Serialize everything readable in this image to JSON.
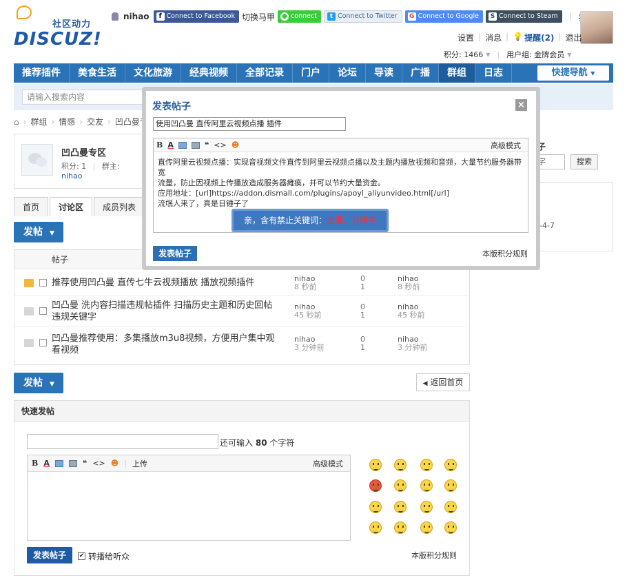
{
  "header": {
    "logo_tagline": "社区动力",
    "logo_word": "DISCUZ!",
    "username": "nihao",
    "connect_facebook": "Connect to Facebook",
    "switch_vest": "切换马甲",
    "connect_line": "connect",
    "connect_twitter": "Connect to Twitter",
    "connect_google": "Connect to Google",
    "connect_steam": "Connect to Steam",
    "my": "我的",
    "settings": "设置",
    "messages": "消息",
    "reminders": "提醒(2)",
    "logout": "退出",
    "points": "积分: 1466",
    "usergroup": "用户组: 金牌会员"
  },
  "nav": {
    "items": [
      "推荐插件",
      "美食生活",
      "文化旅游",
      "经典视频",
      "全部记录",
      "门户",
      "论坛",
      "导读",
      "广播",
      "群组",
      "日志"
    ],
    "quick": "快捷导航"
  },
  "search": {
    "placeholder": "请输入搜索内容"
  },
  "breadcrumb": [
    "群组",
    "情感",
    "交友",
    "凹凸曼专"
  ],
  "group": {
    "name": "凹凸曼专区",
    "points": "积分: 1",
    "leader_label": "群主:",
    "leader": "nihao"
  },
  "tabs": [
    "首页",
    "讨论区",
    "成员列表",
    "管"
  ],
  "post_button": "发帖",
  "threads": {
    "header": "帖子",
    "rows": [
      {
        "title": "推荐使用凹凸曼 直传七牛云视频播放 播放视频插件",
        "author": "nihao",
        "author_time": "8 秒前",
        "replies": "0",
        "views": "1",
        "last": "nihao",
        "last_time": "8 秒前"
      },
      {
        "title": "凹凸曼 洗内容扫描违规帖插件 扫描历史主题和历史回帖违规关键字",
        "author": "nihao",
        "author_time": "45 秒前",
        "replies": "0",
        "views": "1",
        "last": "nihao",
        "last_time": "45 秒前"
      },
      {
        "title": "凹凸曼推荐使用：多集播放m3u8视频，方便用户集中观看视频",
        "author": "nihao",
        "author_time": "3 分钟前",
        "replies": "0",
        "views": "1",
        "last": "nihao",
        "last_time": "3 分钟前"
      }
    ]
  },
  "back_home": "返回首页",
  "quick_post": {
    "title": "快速发帖",
    "count_prefix": "还可输入",
    "count": "80",
    "count_suffix": "个字符",
    "upload": "上传",
    "advanced": "高级模式",
    "submit": "发表帖子",
    "broadcast": "转播给听众",
    "rules": "本版积分规则"
  },
  "right": {
    "post_label": "发帖子",
    "keyword": "关键字",
    "search_btn": "搜索",
    "date": "022-4-7"
  },
  "modal": {
    "title": "发表帖子",
    "subject": "使用凹凸曼 直传阿里云视频点播 插件",
    "advanced": "高级模式",
    "content_lines": [
      "直传阿里云视频点播：实现音视频文件直传到阿里云视频点播以及主题内播放视频和音频，大量节约服务器带宽",
      "流量，防止因视频上传播放造成服务器瘫痪，并可以节约大量资金。",
      "应用地址：[url]https://addon.dismall.com/plugins/apoyl_aliyunvideo.html[/url]",
      "流氓人来了，真是日锤子了"
    ],
    "warn_prefix": "亲，含有禁止关键词：",
    "warn_keywords": "流氓、日锤子",
    "submit": "发表帖子",
    "rules": "本版积分规则"
  },
  "colors": {
    "nav": "#2b73b7",
    "accent": "#1f5aa6",
    "warn_keyword": "#ff2a2a"
  }
}
